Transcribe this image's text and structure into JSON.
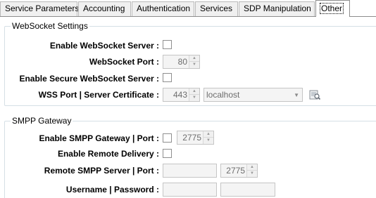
{
  "tabs": [
    {
      "label": "Service Parameters",
      "active": false
    },
    {
      "label": "Accounting",
      "active": false
    },
    {
      "label": "Authentication",
      "active": false
    },
    {
      "label": "Services",
      "active": false
    },
    {
      "label": "SDP Manipulation",
      "active": false
    },
    {
      "label": "Other",
      "active": true
    }
  ],
  "websocket": {
    "title": "WebSocket Settings",
    "enable_label": "Enable WebSocket Server :",
    "port_label": "WebSocket Port :",
    "port_value": "80",
    "secure_label": "Enable Secure WebSocket Server :",
    "wss_label": "WSS Port | Server Certificate :",
    "wss_port_value": "443",
    "certificate_value": "localhost",
    "browse_icon": "certificate-browse-icon"
  },
  "smpp": {
    "title": "SMPP Gateway",
    "enable_label": "Enable SMPP Gateway | Port :",
    "port_value": "2775",
    "remote_delivery_label": "Enable Remote Delivery :",
    "remote_server_label": "Remote SMPP Server | Port :",
    "remote_server_value": "",
    "remote_port_value": "2775",
    "credentials_label": "Username | Password :",
    "username_value": "",
    "password_value": ""
  }
}
